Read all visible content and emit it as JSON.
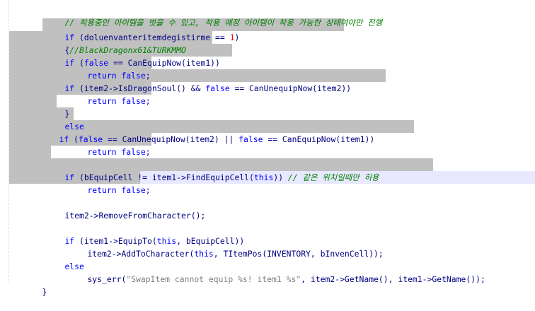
{
  "colors": {
    "keyword": "#0000ff",
    "comment": "#008000",
    "number": "#ff0000",
    "string": "#808080",
    "identifier": "#000080",
    "selection": "#c0c0c0",
    "current_line": "#e8e8ff"
  },
  "code": {
    "l1": {
      "comment": "// 착용중인 아이템을 벗을 수 있고, 착용 예정 아이템이 착용 가능한 상태여야만 진행"
    },
    "l2": {
      "kw_if": "if",
      "p1": " (doluenvanteritemdegistirme == ",
      "num": "1",
      "p2": ")"
    },
    "l3": {
      "brace": "{",
      "comment": "//BlackDragonx61&TURKMMO"
    },
    "l4": {
      "kw_if": "if",
      "p1": " (",
      "kw_false": "false",
      "p2": " == CanEquipNow(item1))"
    },
    "l5": {
      "kw_return": "return",
      "kw_false": "false",
      "semi": ";"
    },
    "l6": {
      "kw_if": "if",
      "p1": " (item2->IsDragonSoul() && ",
      "kw_false": "false",
      "p2": " == CanUnequipNow(item2))"
    },
    "l7": {
      "kw_return": "return",
      "kw_false": "false",
      "semi": ";"
    },
    "l8": {
      "brace": "}"
    },
    "l9": {
      "kw_else": "else"
    },
    "l10": {
      "kw_if": "if",
      "p1": " (",
      "kw_false1": "false",
      "p2": " == CanUnequipNow(item2) || ",
      "kw_false2": "false",
      "p3": " == CanEquipNow(item1))"
    },
    "l11": {
      "kw_return": "return",
      "kw_false": "false",
      "semi": ";"
    },
    "l13": {
      "kw_if": "if",
      "p1": " (bEquipCell != item1->FindEquipCell(",
      "kw_this": "this",
      "p2": ")) ",
      "comment": "// 같은 위치일때만 허용"
    },
    "l14": {
      "kw_return": "return",
      "kw_false": "false",
      "semi": ";"
    },
    "l16": {
      "text": "item2->RemoveFromCharacter();"
    },
    "l18": {
      "kw_if": "if",
      "p1": " (item1->EquipTo(",
      "kw_this": "this",
      "p2": ", bEquipCell))"
    },
    "l19": {
      "p1": "item2->AddToCharacter(",
      "kw_this": "this",
      "p2": ", TItemPos(INVENTORY, bInvenCell));"
    },
    "l20": {
      "kw_else": "else"
    },
    "l21": {
      "p1": "sys_err(",
      "str": "\"SwapItem cannot equip %s! item1 %s\"",
      "p2": ", item2->GetName(), item1->GetName());"
    },
    "l22": {
      "brace": "}"
    }
  }
}
